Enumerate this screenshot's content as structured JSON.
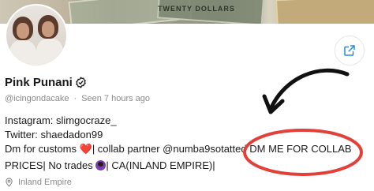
{
  "banner": {
    "note_text": "TWENTY DOLLARS"
  },
  "profile": {
    "name": "Pink Punani",
    "handle": "@icingondacake",
    "separator": "·",
    "seen": "Seen  7 hours ago"
  },
  "bio": {
    "line1": "Instagram: slimgocraze_",
    "line2": "Twitter: shaedadon99",
    "line3_a": "Dm for customs ",
    "line3_heart": "❤️",
    "line3_b": "| collab partner @numba9sotatted ",
    "line3_highlight": "DM ME FOR COLLAB",
    "line4_a": "PRICES| No trades ",
    "line4_b": "| CA(INLAND EMPIRE)|"
  },
  "location": {
    "text": "Inland Empire"
  },
  "icons": {
    "verified": "verified-badge-icon",
    "share": "share-icon",
    "location": "location-pin-icon",
    "annotation_arrow": "arrow-icon",
    "annotation_circle": "highlight-circle"
  },
  "colors": {
    "accent": "#1f8fd6",
    "annotation": "#e2413a",
    "muted_text": "#8a8a8a"
  }
}
